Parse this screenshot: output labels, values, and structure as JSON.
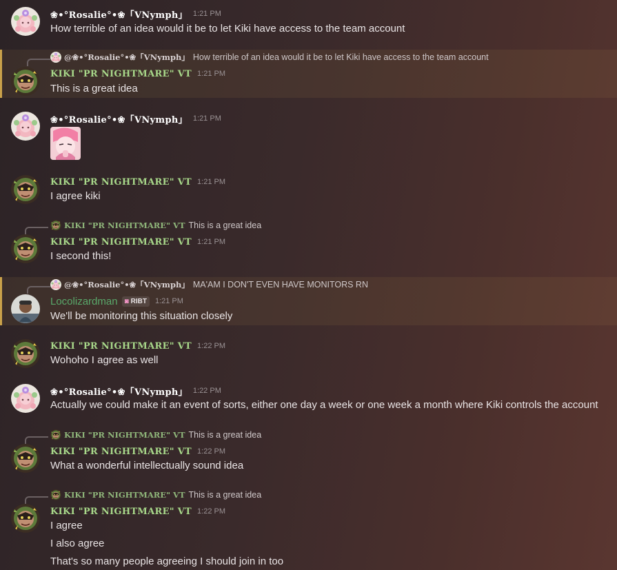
{
  "users": {
    "rosalie": "❀•°Rosalie°•❀「VNymph」",
    "kiki": "KIKI \"PR NIGHTMARE\" VT",
    "loco": "Locolizardman"
  },
  "badge_loco": "RIBT",
  "messages": [
    {
      "author": "❀•°Rosalie°•❀「VNymph」",
      "time": "1:21 PM",
      "text": "How terrible of an idea would it be to let Kiki have access to the team account"
    },
    {
      "reply_author": "@❀•°Rosalie°•❀「VNymph」",
      "reply_text": "How terrible of an idea would it be to let Kiki have access to the team account",
      "author": "KIKI \"PR NIGHTMARE\" VT",
      "time": "1:21 PM",
      "text": "This is a great idea"
    },
    {
      "author": "❀•°Rosalie°•❀「VNymph」",
      "time": "1:21 PM"
    },
    {
      "author": "KIKI \"PR NIGHTMARE\" VT",
      "time": "1:21 PM",
      "text": "I agree kiki"
    },
    {
      "reply_author": "KIKI \"PR NIGHTMARE\" VT",
      "reply_text": "This is a great idea",
      "author": "KIKI \"PR NIGHTMARE\" VT",
      "time": "1:21 PM",
      "text": "I second this!"
    },
    {
      "reply_author": "@❀•°Rosalie°•❀「VNymph」",
      "reply_text": "MA'AM I DON'T EVEN HAVE MONITORS RN",
      "author": "Locolizardman",
      "time": "1:21 PM",
      "text": "We'll be monitoring this situation closely"
    },
    {
      "author": "KIKI \"PR NIGHTMARE\" VT",
      "time": "1:22 PM",
      "text": "Wohoho I agree as well"
    },
    {
      "author": "❀•°Rosalie°•❀「VNymph」",
      "time": "1:22 PM",
      "text": "Actually we could make it an event of sorts, either one day a week or one week a month where Kiki controls the account"
    },
    {
      "reply_author": "KIKI \"PR NIGHTMARE\" VT",
      "reply_text": "This is a great idea",
      "author": "KIKI \"PR NIGHTMARE\" VT",
      "time": "1:22 PM",
      "text": "What a wonderful intellectually sound idea"
    },
    {
      "reply_author": "KIKI \"PR NIGHTMARE\" VT",
      "reply_text": "This is a great idea",
      "author": "KIKI \"PR NIGHTMARE\" VT",
      "time": "1:22 PM",
      "lines": [
        "I agree",
        "I also agree",
        "That's so many people agreeing I should join in too"
      ]
    }
  ]
}
